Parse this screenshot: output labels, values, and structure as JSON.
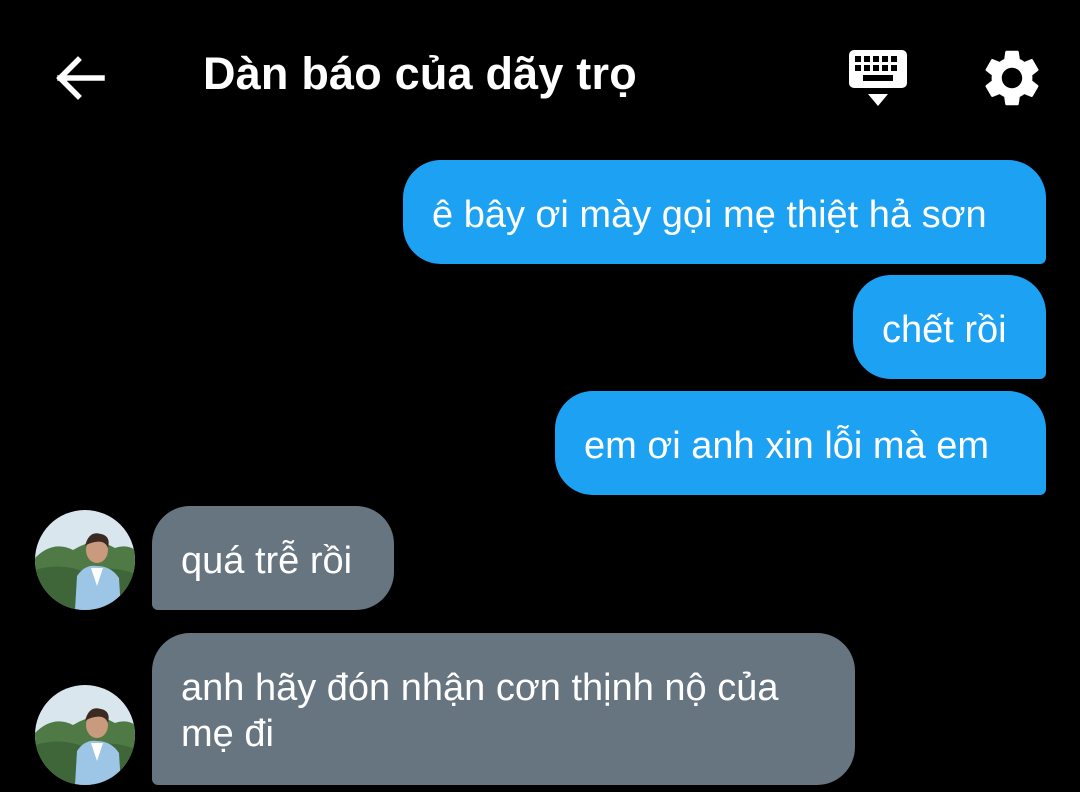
{
  "header": {
    "title": "Dàn báo của dãy trọ",
    "back_icon": "arrow-left-icon",
    "keyboard_icon": "keyboard-hide-icon",
    "settings_icon": "gear-icon"
  },
  "colors": {
    "background": "#000000",
    "sent_bubble": "#1da1f2",
    "received_bubble": "#66757f",
    "text": "#ffffff"
  },
  "messages": [
    {
      "direction": "sent",
      "text": "ê bây ơi mày gọi mẹ thiệt hả sơn"
    },
    {
      "direction": "sent",
      "text": "chết rồi"
    },
    {
      "direction": "sent",
      "text": "em ơi anh xin lỗi mà em"
    },
    {
      "direction": "received",
      "text": "quá trễ rồi"
    },
    {
      "direction": "received",
      "text": "anh hãy đón nhận cơn thịnh nộ của mẹ đi"
    }
  ]
}
